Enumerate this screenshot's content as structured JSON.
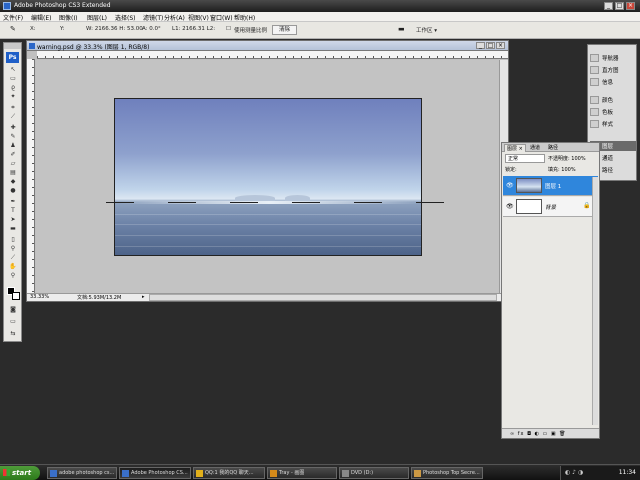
{
  "window": {
    "title": "Adobe Photoshop CS3 Extended"
  },
  "menu": [
    "文件(F)",
    "编辑(E)",
    "图像(I)",
    "图层(L)",
    "选择(S)",
    "滤镜(T)",
    "分析(A)",
    "视图(V)",
    "窗口(W)",
    "帮助(H)"
  ],
  "options_bar": {
    "x_label": "X:",
    "y_label": "Y:",
    "w_value": "W: 2166.36 H: 53.00",
    "angle_value": "A: 0.0°",
    "length_value": "L1: 2166.31 L2:",
    "checkbox_label": "使用测量比例",
    "clear_button": "清除",
    "workspace": "工作区 ▾"
  },
  "toolbox": {
    "logo": "Ps"
  },
  "document": {
    "title": "warning.psd @ 33.3% (图层 1, RGB/8)",
    "zoom": "33.33%",
    "status": "文档:5.93M/13.2M"
  },
  "right_dock": [
    {
      "icon": "navigator-icon",
      "label": "导航器"
    },
    {
      "icon": "histogram-icon",
      "label": "直方图"
    },
    {
      "icon": "info-icon",
      "label": "信息"
    },
    {
      "icon": "color-icon",
      "label": "颜色"
    },
    {
      "icon": "swatches-icon",
      "label": "色板"
    },
    {
      "icon": "styles-icon",
      "label": "样式"
    },
    {
      "icon": "layers-icon",
      "label": "图层"
    },
    {
      "icon": "channels-icon",
      "label": "通道"
    },
    {
      "icon": "paths-icon",
      "label": "路径"
    }
  ],
  "layers_panel": {
    "tabs": [
      "图层 ×",
      "通道",
      "路径"
    ],
    "blend_mode": "正常",
    "opacity": "不透明度: 100%",
    "fill": "填充: 100%",
    "lock": "锁定:",
    "layers": [
      {
        "name": "图层 1",
        "selected": true
      },
      {
        "name": "背景",
        "selected": false
      }
    ],
    "bottom_icons": "∞ fx ◘ ◐ ▭ ▣ 🗑"
  },
  "taskbar": {
    "start": "start",
    "buttons": [
      "adobe photoshop cs...",
      "Adobe Photoshop CS...",
      "QQ:1 我的QQ 聊天...",
      "Tray - 画图",
      "DVD (D:)",
      "Photoshop Top Secre..."
    ],
    "clock": "11:34"
  }
}
